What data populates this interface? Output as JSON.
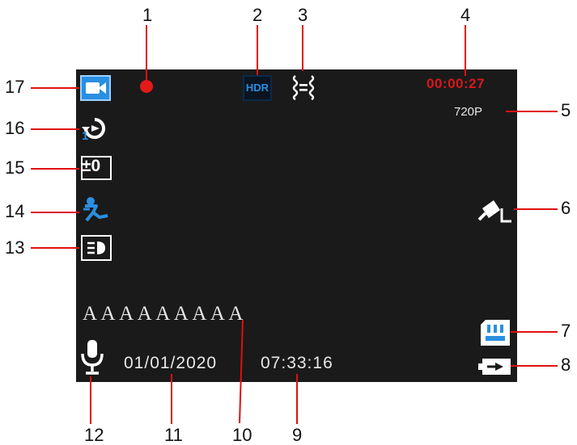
{
  "callouts": [
    "1",
    "2",
    "3",
    "4",
    "5",
    "6",
    "7",
    "8",
    "9",
    "10",
    "11",
    "12",
    "13",
    "14",
    "15",
    "16",
    "17"
  ],
  "screen": {
    "hdr_label": "HDR",
    "record_timer": "00:00:27",
    "resolution": "720P",
    "exposure_value": "±0",
    "loop_number": "1",
    "date_stamp_text": "AAAAAAAAA",
    "date": "01/01/2020",
    "time": "07:33:16"
  },
  "icons": {
    "c1": "recording-dot-icon",
    "c3": "image-stabilizer-icon",
    "c6": "parking-monitor-icon",
    "c7": "sd-card-icon",
    "c8": "battery-charging-icon",
    "c12": "microphone-icon",
    "c13": "headlight-icon",
    "c14": "motion-detection-icon",
    "c16": "loop-recording-icon",
    "c17": "video-mode-icon"
  },
  "colors": {
    "screen_bg": "#1a1a1a",
    "leader_red": "#e01010",
    "accent_blue": "#2a8fe0",
    "timer_red": "#d9181a"
  }
}
